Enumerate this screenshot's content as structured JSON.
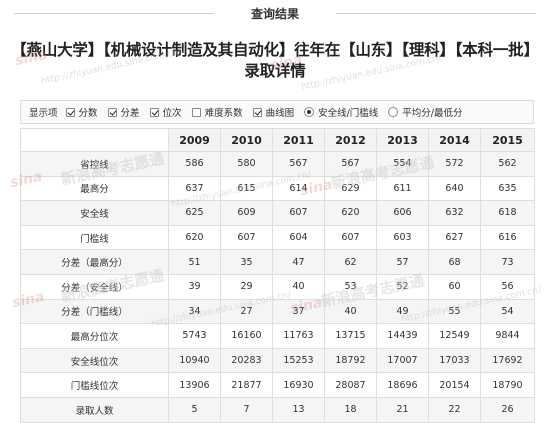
{
  "header": {
    "title": "查询结果",
    "headline": "【燕山大学】【机械设计制造及其自动化】往年在【山东】【理科】【本科一批】录取详情"
  },
  "options": {
    "lead": "显示项",
    "checkboxes": [
      {
        "label": "分数",
        "checked": true
      },
      {
        "label": "分差",
        "checked": true
      },
      {
        "label": "位次",
        "checked": true
      },
      {
        "label": "难度系数",
        "checked": false
      },
      {
        "label": "曲线图",
        "checked": true
      }
    ],
    "radios": [
      {
        "label": "安全线/门槛线",
        "selected": true
      },
      {
        "label": "平均分/最低分",
        "selected": false
      }
    ]
  },
  "table": {
    "years": [
      "2009",
      "2010",
      "2011",
      "2012",
      "2013",
      "2014",
      "2015"
    ],
    "rows": [
      {
        "label": "省控线",
        "values": [
          "586",
          "580",
          "567",
          "567",
          "554",
          "572",
          "562"
        ]
      },
      {
        "label": "最高分",
        "values": [
          "637",
          "615",
          "614",
          "629",
          "611",
          "640",
          "635"
        ]
      },
      {
        "label": "安全线",
        "values": [
          "625",
          "609",
          "607",
          "620",
          "606",
          "632",
          "618"
        ]
      },
      {
        "label": "门槛线",
        "values": [
          "620",
          "607",
          "604",
          "607",
          "603",
          "627",
          "616"
        ]
      },
      {
        "label": "分差（最高分）",
        "values": [
          "51",
          "35",
          "47",
          "62",
          "57",
          "68",
          "73"
        ]
      },
      {
        "label": "分差（安全线）",
        "values": [
          "39",
          "29",
          "40",
          "53",
          "52",
          "60",
          "56"
        ]
      },
      {
        "label": "分差（门槛线）",
        "values": [
          "34",
          "27",
          "37",
          "40",
          "49",
          "55",
          "54"
        ]
      },
      {
        "label": "最高分位次",
        "values": [
          "5743",
          "16160",
          "11763",
          "13715",
          "14439",
          "12549",
          "9844"
        ]
      },
      {
        "label": "安全线位次",
        "values": [
          "10940",
          "20283",
          "15253",
          "18792",
          "17007",
          "17033",
          "17692"
        ]
      },
      {
        "label": "门槛线位次",
        "values": [
          "13906",
          "21877",
          "16930",
          "28087",
          "18696",
          "20154",
          "18790"
        ]
      },
      {
        "label": "录取人数",
        "values": [
          "5",
          "7",
          "13",
          "18",
          "21",
          "22",
          "26"
        ]
      }
    ]
  },
  "watermark": {
    "brand": "新浪高考志愿通",
    "logo": "sina",
    "url": "http://zhiyuan.edu.sina.com.cn/"
  }
}
